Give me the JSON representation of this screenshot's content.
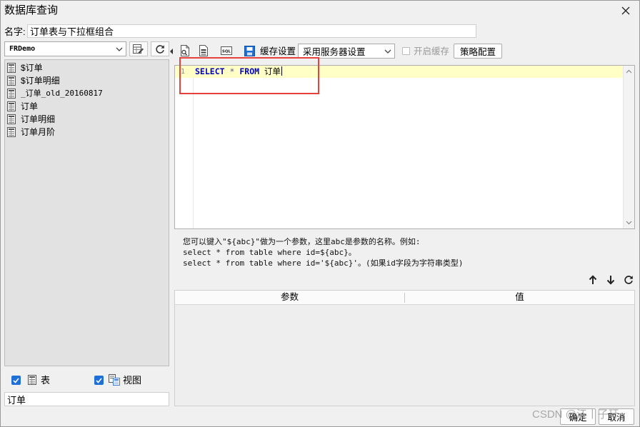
{
  "window": {
    "title": "数据库查询",
    "close_icon": "close-icon"
  },
  "name_field": {
    "label": "名字:",
    "value": "订单表与下拉框组合"
  },
  "datasource": {
    "selected": "FRDemo",
    "icon": "chevron-down-icon"
  },
  "left_toolbar": {
    "icons": [
      "table-edit-icon",
      "refresh-icon"
    ]
  },
  "tables": [
    {
      "label": "$订单",
      "icon": "table-icon"
    },
    {
      "label": "$订单明细",
      "icon": "table-icon"
    },
    {
      "label": "_订单_old_20160817",
      "icon": "table-icon"
    },
    {
      "label": "订单",
      "icon": "table-icon"
    },
    {
      "label": "订单明细",
      "icon": "table-icon"
    },
    {
      "label": "订单月阶",
      "icon": "table-icon"
    }
  ],
  "filters": {
    "table": {
      "label": "表",
      "checked": true,
      "icon": "table-icon"
    },
    "view": {
      "label": "视图",
      "checked": true,
      "icon": "view-icon"
    }
  },
  "table_search": {
    "value": "订单"
  },
  "query_toolbar": {
    "icons": [
      "preview-icon",
      "template-icon",
      "sql-icon",
      "cache-icon"
    ],
    "sql_icon_label": "SQL",
    "cache_label": "缓存设置",
    "cache_mode": "采用服务器设置",
    "enable_cache": {
      "label": "开启缓存",
      "checked": false
    },
    "strategy_button": "策略配置"
  },
  "editor": {
    "current_line_color": "#ffffc6",
    "lines": [
      {
        "number": "1",
        "tokens": [
          {
            "text": "SELECT",
            "color": "#0000c4"
          },
          {
            "text": "*",
            "color": "#5a5a9a"
          },
          {
            "text": "FROM",
            "color": "#0000c4"
          },
          {
            "text": "订单",
            "color": "#000000"
          }
        ]
      }
    ]
  },
  "annotation_color": "#e8403a",
  "hint": [
    "您可以键入\"${abc}\"做为一个参数，这里abc是参数的名称。例如:",
    "select * from table where id=${abc}。",
    "select * from table where id='${abc}'。(如果id字段为字符串类型)"
  ],
  "params": {
    "tool_icons": [
      "arrow-up-icon",
      "arrow-down-icon",
      "refresh-icon"
    ],
    "columns": [
      "参数",
      "值"
    ],
    "rows": []
  },
  "footer": {
    "ok_button": "确定",
    "cancel_button": "取消"
  },
  "watermark": "CSDN @江丨子玗"
}
